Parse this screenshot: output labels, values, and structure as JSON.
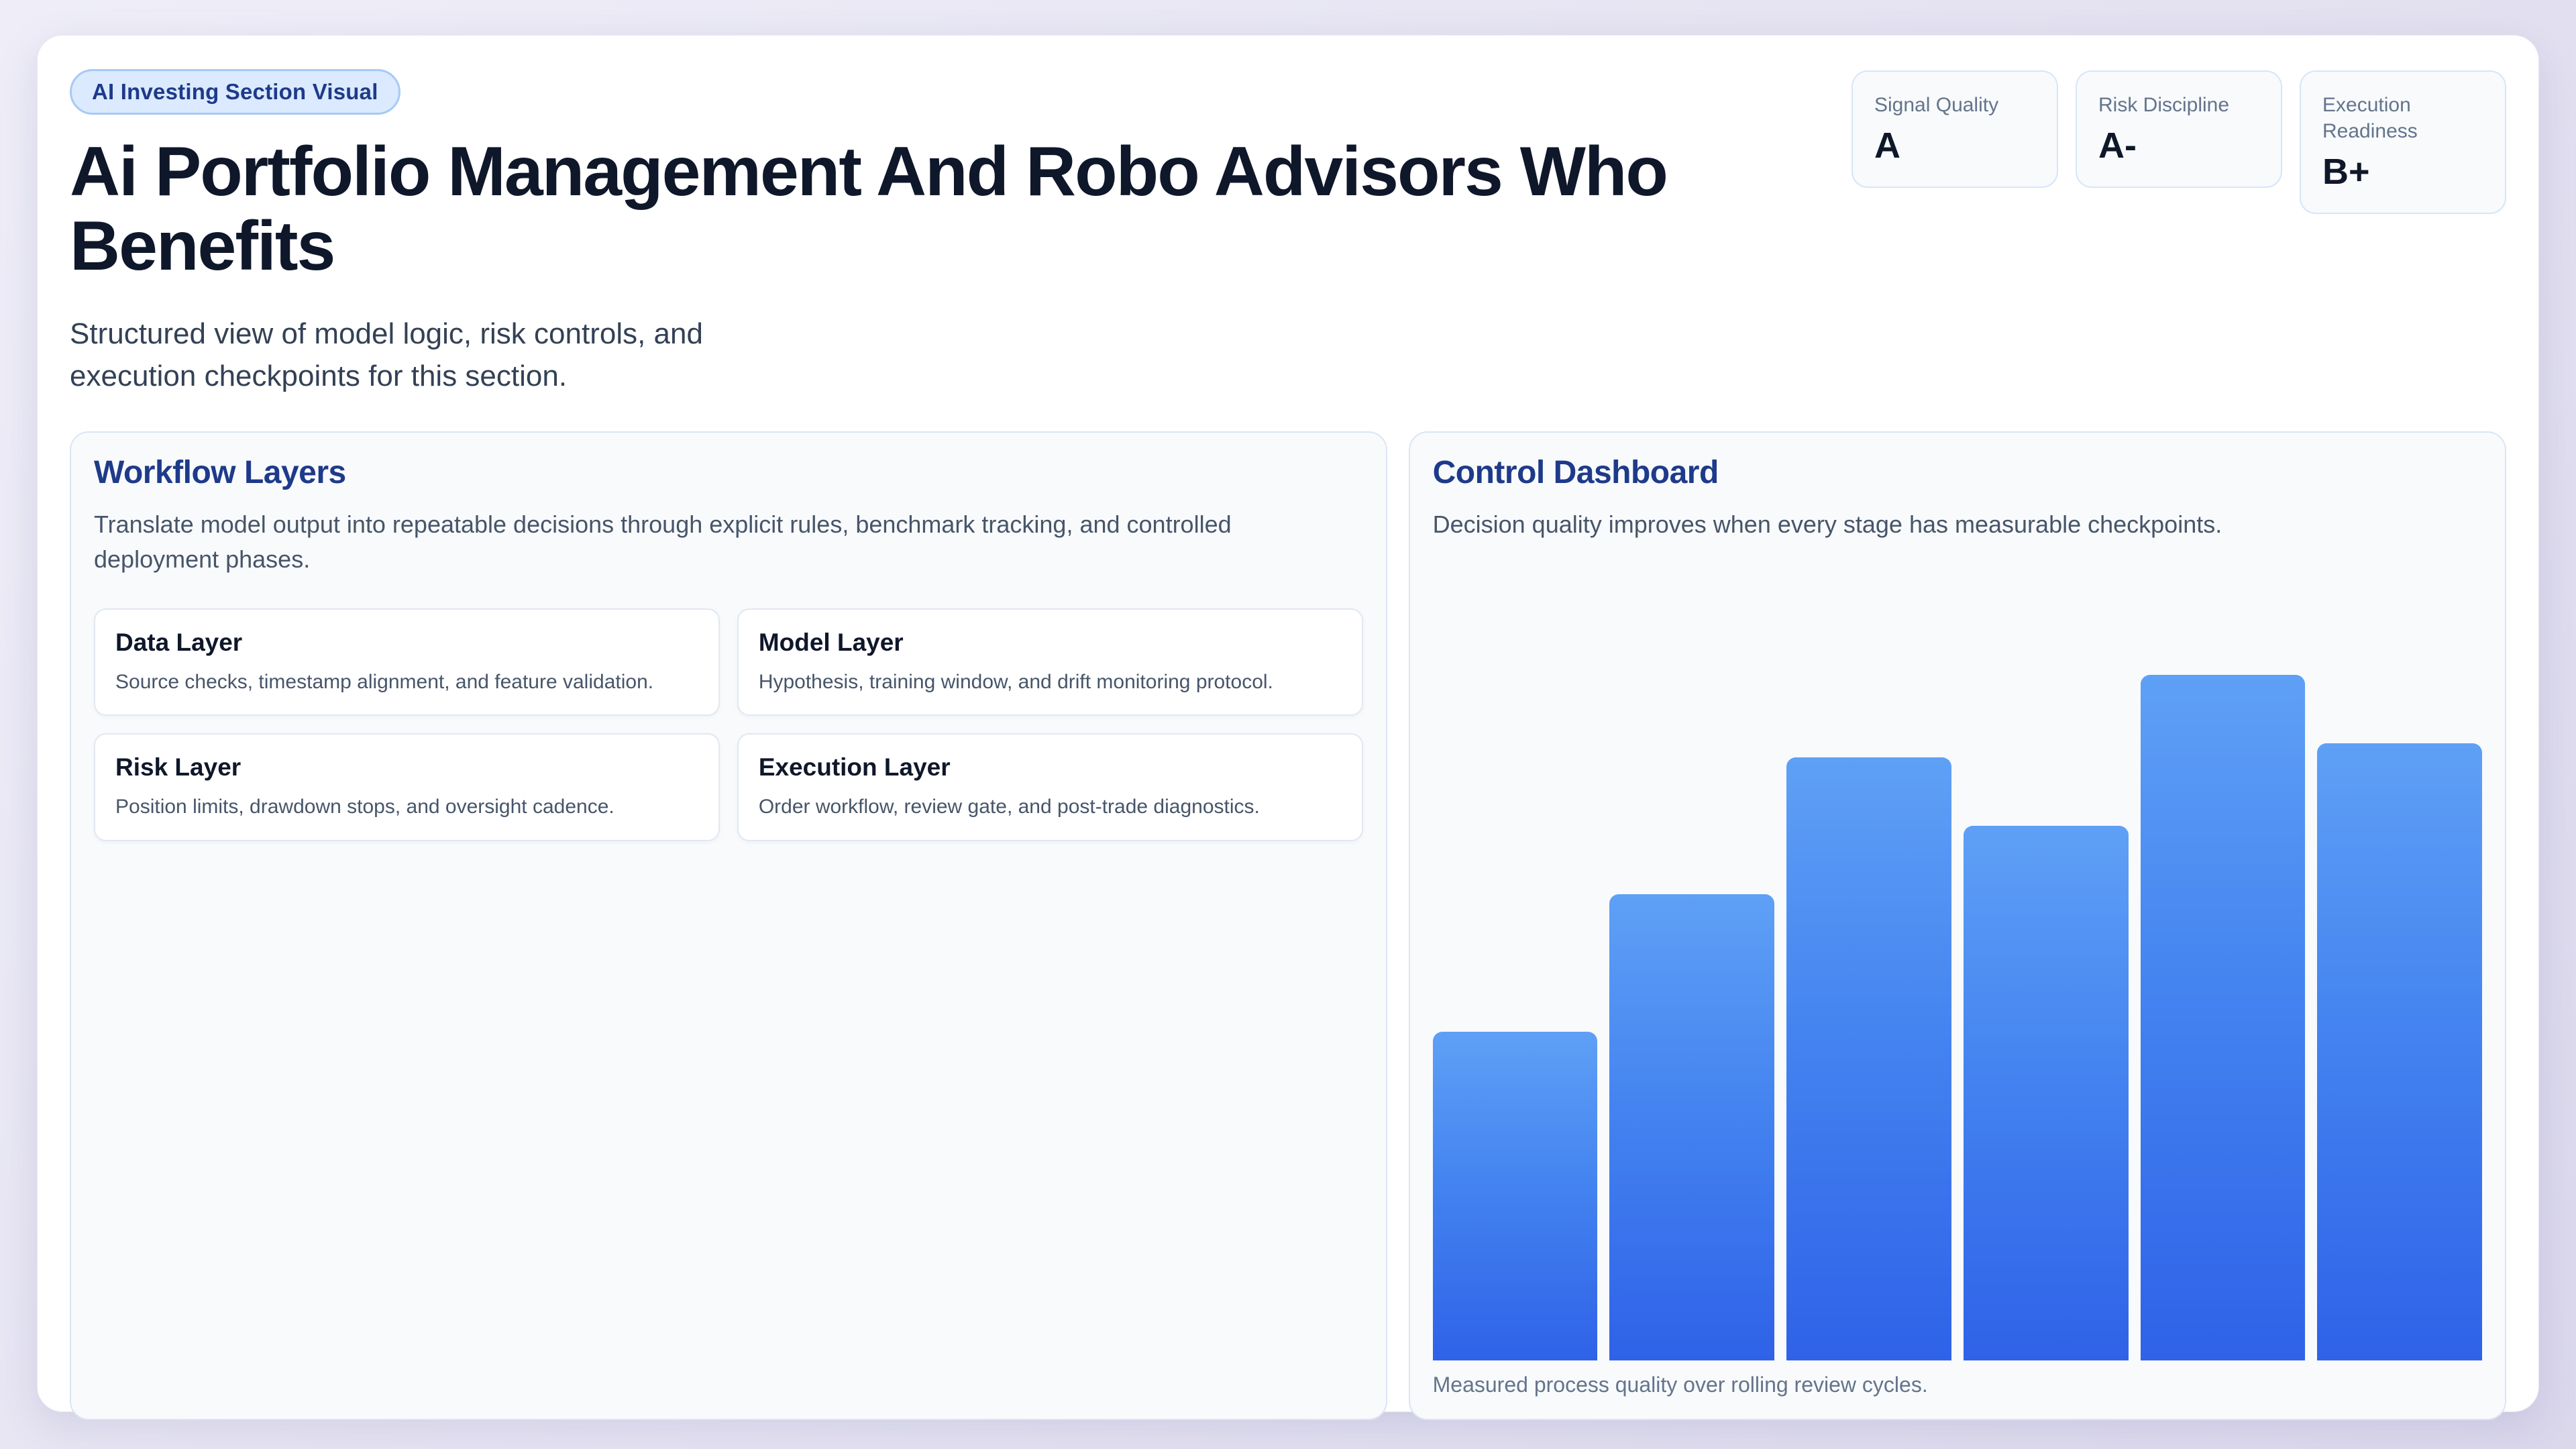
{
  "badge": "AI Investing Section Visual",
  "title": "Ai Portfolio Management And Robo Advisors Who Benefits",
  "subtitle": "Structured view of model logic, risk controls, and execution checkpoints for this section.",
  "stats": [
    {
      "label": "Signal Quality",
      "value": "A"
    },
    {
      "label": "Risk Discipline",
      "value": "A-"
    },
    {
      "label": "Execution Readiness",
      "value": "B+"
    }
  ],
  "workflow": {
    "title": "Workflow Layers",
    "description": "Translate model output into repeatable decisions through explicit rules, benchmark tracking, and controlled deployment phases.",
    "layers": [
      {
        "title": "Data Layer",
        "description": "Source checks, timestamp alignment, and feature validation."
      },
      {
        "title": "Model Layer",
        "description": "Hypothesis, training window, and drift monitoring protocol."
      },
      {
        "title": "Risk Layer",
        "description": "Position limits, drawdown stops, and oversight cadence."
      },
      {
        "title": "Execution Layer",
        "description": "Order workflow, review gate, and post-trade diagnostics."
      }
    ]
  },
  "dashboard": {
    "title": "Control Dashboard",
    "description": "Decision quality improves when every stage has measurable checkpoints.",
    "caption": "Measured process quality over rolling review cycles."
  },
  "chart_data": {
    "type": "bar",
    "title": "Control Dashboard",
    "categories": [
      "",
      "",
      "",
      "",
      "",
      ""
    ],
    "values": [
      48,
      68,
      88,
      78,
      100,
      90
    ],
    "ylabel": "",
    "xlabel": "",
    "ylim": [
      0,
      100
    ],
    "grid": false,
    "legend": false,
    "bar_gradient_top": "#5fa0f6",
    "bar_gradient_bottom": "#2f62e8",
    "note_caption": "Measured process quality over rolling review cycles."
  },
  "colors": {
    "accent_blue": "#2563eb",
    "light_blue": "#60a5fa",
    "badge_bg": "#dbeafe",
    "badge_text": "#1e3a8a",
    "heading": "#0f172a",
    "panel_title": "#1e3a8a",
    "muted_text": "#64748b",
    "body_text": "#475569",
    "panel_bg": "#f8fafc",
    "card_bg": "#ffffff"
  }
}
